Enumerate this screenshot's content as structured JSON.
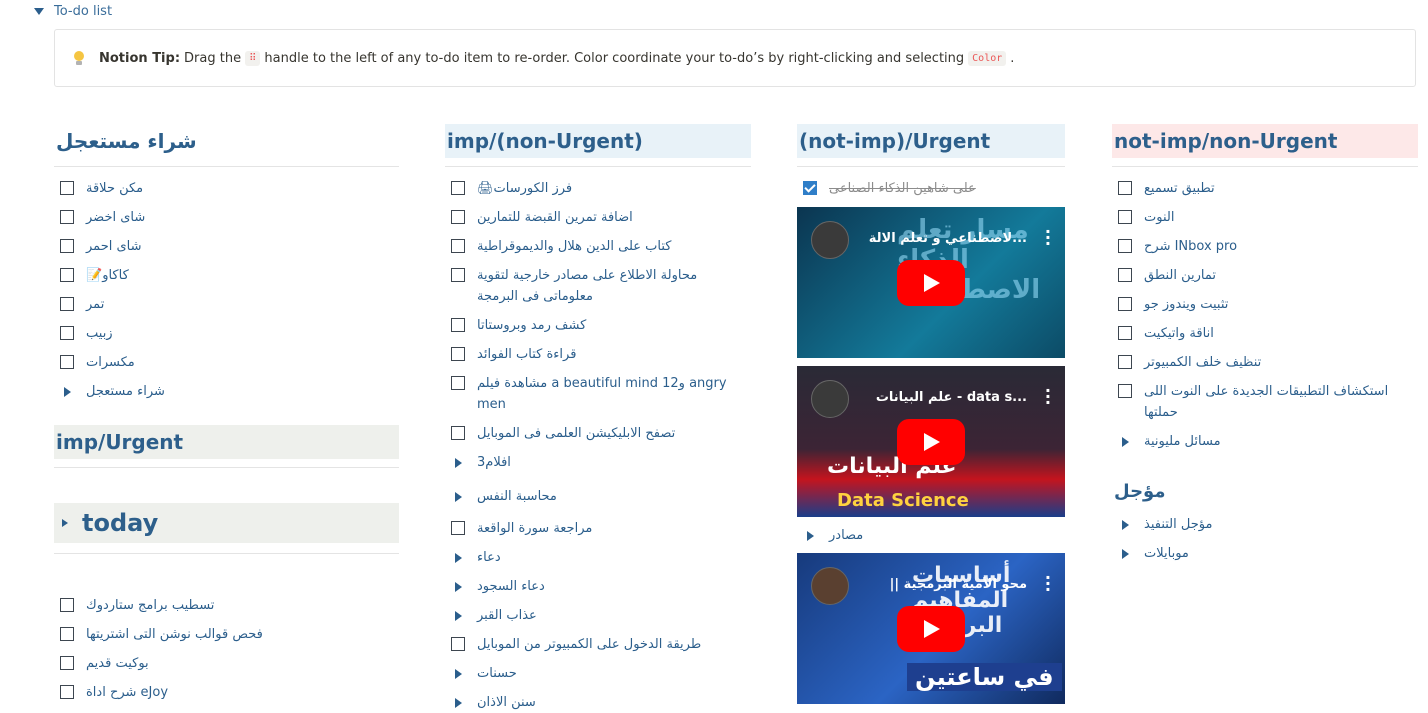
{
  "toggle": {
    "label": "To-do list"
  },
  "tip": {
    "title": "Notion Tip:",
    "text1": "Drag the",
    "handle": "⠿",
    "text2": "handle to the left of any to-do item to re-order. Color coordinate your to-do’s by right-clicking and selecting",
    "code": "Color",
    "text3": "."
  },
  "col1": {
    "title": "شراء مستعجل",
    "items": [
      "مكن حلاقة",
      "شاى اخضر",
      "شاى احمر",
      "📝كاكاو",
      "تمر",
      "زبيب",
      "مكسرات"
    ],
    "toggle": "شراء مستعجل",
    "title2": "imp/Urgent",
    "today": "today",
    "items2": [
      "تسطيب برامج ستاردوك",
      "فحص قوالب نوشن التى اشتريتها",
      "بوكيت قديم",
      "شرح اداة eJoy"
    ]
  },
  "col2": {
    "title": "imp/(non-Urgent)",
    "rows": [
      {
        "type": "todo",
        "text": "🖨فرز الكورسات"
      },
      {
        "type": "todo",
        "text": "اضافة تمرين القبضة للتمارين"
      },
      {
        "type": "todo",
        "text": "كتاب على الدين هلال والديموقراطية"
      },
      {
        "type": "todo",
        "text": "محاولة الاطلاع على مصادر خارجية لتقوية معلوماتى فى البرمجة"
      },
      {
        "type": "todo",
        "text": "كشف رمد وبروستاتا"
      },
      {
        "type": "todo",
        "text": "قراءة كتاب الفوائد"
      },
      {
        "type": "todo",
        "text": "مشاهدة فيلم a beautiful mind و12 angry men"
      },
      {
        "type": "todo",
        "text": "تصفح الابليكيشن العلمى فى الموبايل"
      },
      {
        "type": "toggle",
        "text": "افلام3"
      },
      {
        "type": "toggle",
        "text": "محاسبة النفس"
      },
      {
        "type": "todo",
        "text": "مراجعة سورة الواقعة"
      },
      {
        "type": "toggle",
        "text": "دعاء"
      },
      {
        "type": "toggle",
        "text": "دعاء السجود"
      },
      {
        "type": "toggle",
        "text": "عذاب القبر"
      },
      {
        "type": "todo",
        "text": "طريقة الدخول على الكمبيوتر من الموبايل"
      },
      {
        "type": "toggle",
        "text": "حسنات"
      },
      {
        "type": "toggle",
        "text": "سنن الاذان"
      }
    ]
  },
  "col3": {
    "title": "(not-imp)/Urgent",
    "checked_item": "على شاهين الذكاء الصناعى",
    "videos": [
      {
        "title": "لاصطناعي و تعلم الالة...",
        "overlay": "مسار تعلم الذكاء الاصطناعي",
        "bg": "#0f5a7a"
      },
      {
        "title": "علم البيانات - data s...",
        "overlay": "علم البيانات",
        "overlay2": "Data Science",
        "bg": "#2a1f2f"
      },
      {
        "title": "|| محو الأمية البرمجية",
        "overlay": "أساسيات المفاهيم البرمجية",
        "overlay2": "في ساعتين",
        "bg": "#1a3a7a"
      }
    ],
    "toggle": "مصادر"
  },
  "col4": {
    "title": "not-imp/non-Urgent",
    "rows": [
      {
        "type": "todo",
        "text": "تطبيق  تسميع"
      },
      {
        "type": "todo",
        "text": "النوت"
      },
      {
        "type": "todo",
        "text": "شرح INbox pro"
      },
      {
        "type": "todo",
        "text": "تمارين النطق"
      },
      {
        "type": "todo",
        "text": "تثبيت ويندوز جو"
      },
      {
        "type": "todo",
        "text": "اناقة واتيكيت"
      },
      {
        "type": "todo",
        "text": "تنظيف خلف الكمبيوتر"
      },
      {
        "type": "todo",
        "text": "استكشاف التطبيقات الجديدة على النوت اللى حملتها"
      },
      {
        "type": "toggle",
        "text": "مسائل مليونية"
      }
    ],
    "sub": "مؤجل",
    "rows2": [
      {
        "type": "toggle",
        "text": "مؤجل التنفيذ"
      },
      {
        "type": "toggle",
        "text": "موبايلات"
      }
    ]
  },
  "colors": {
    "text": "#2b5e8c",
    "imp_bg": "#e8f2f8",
    "notimp_bg": "#fde8e8",
    "urgent_bg": "#eef0ec",
    "today_bg": "#eef0ec"
  }
}
